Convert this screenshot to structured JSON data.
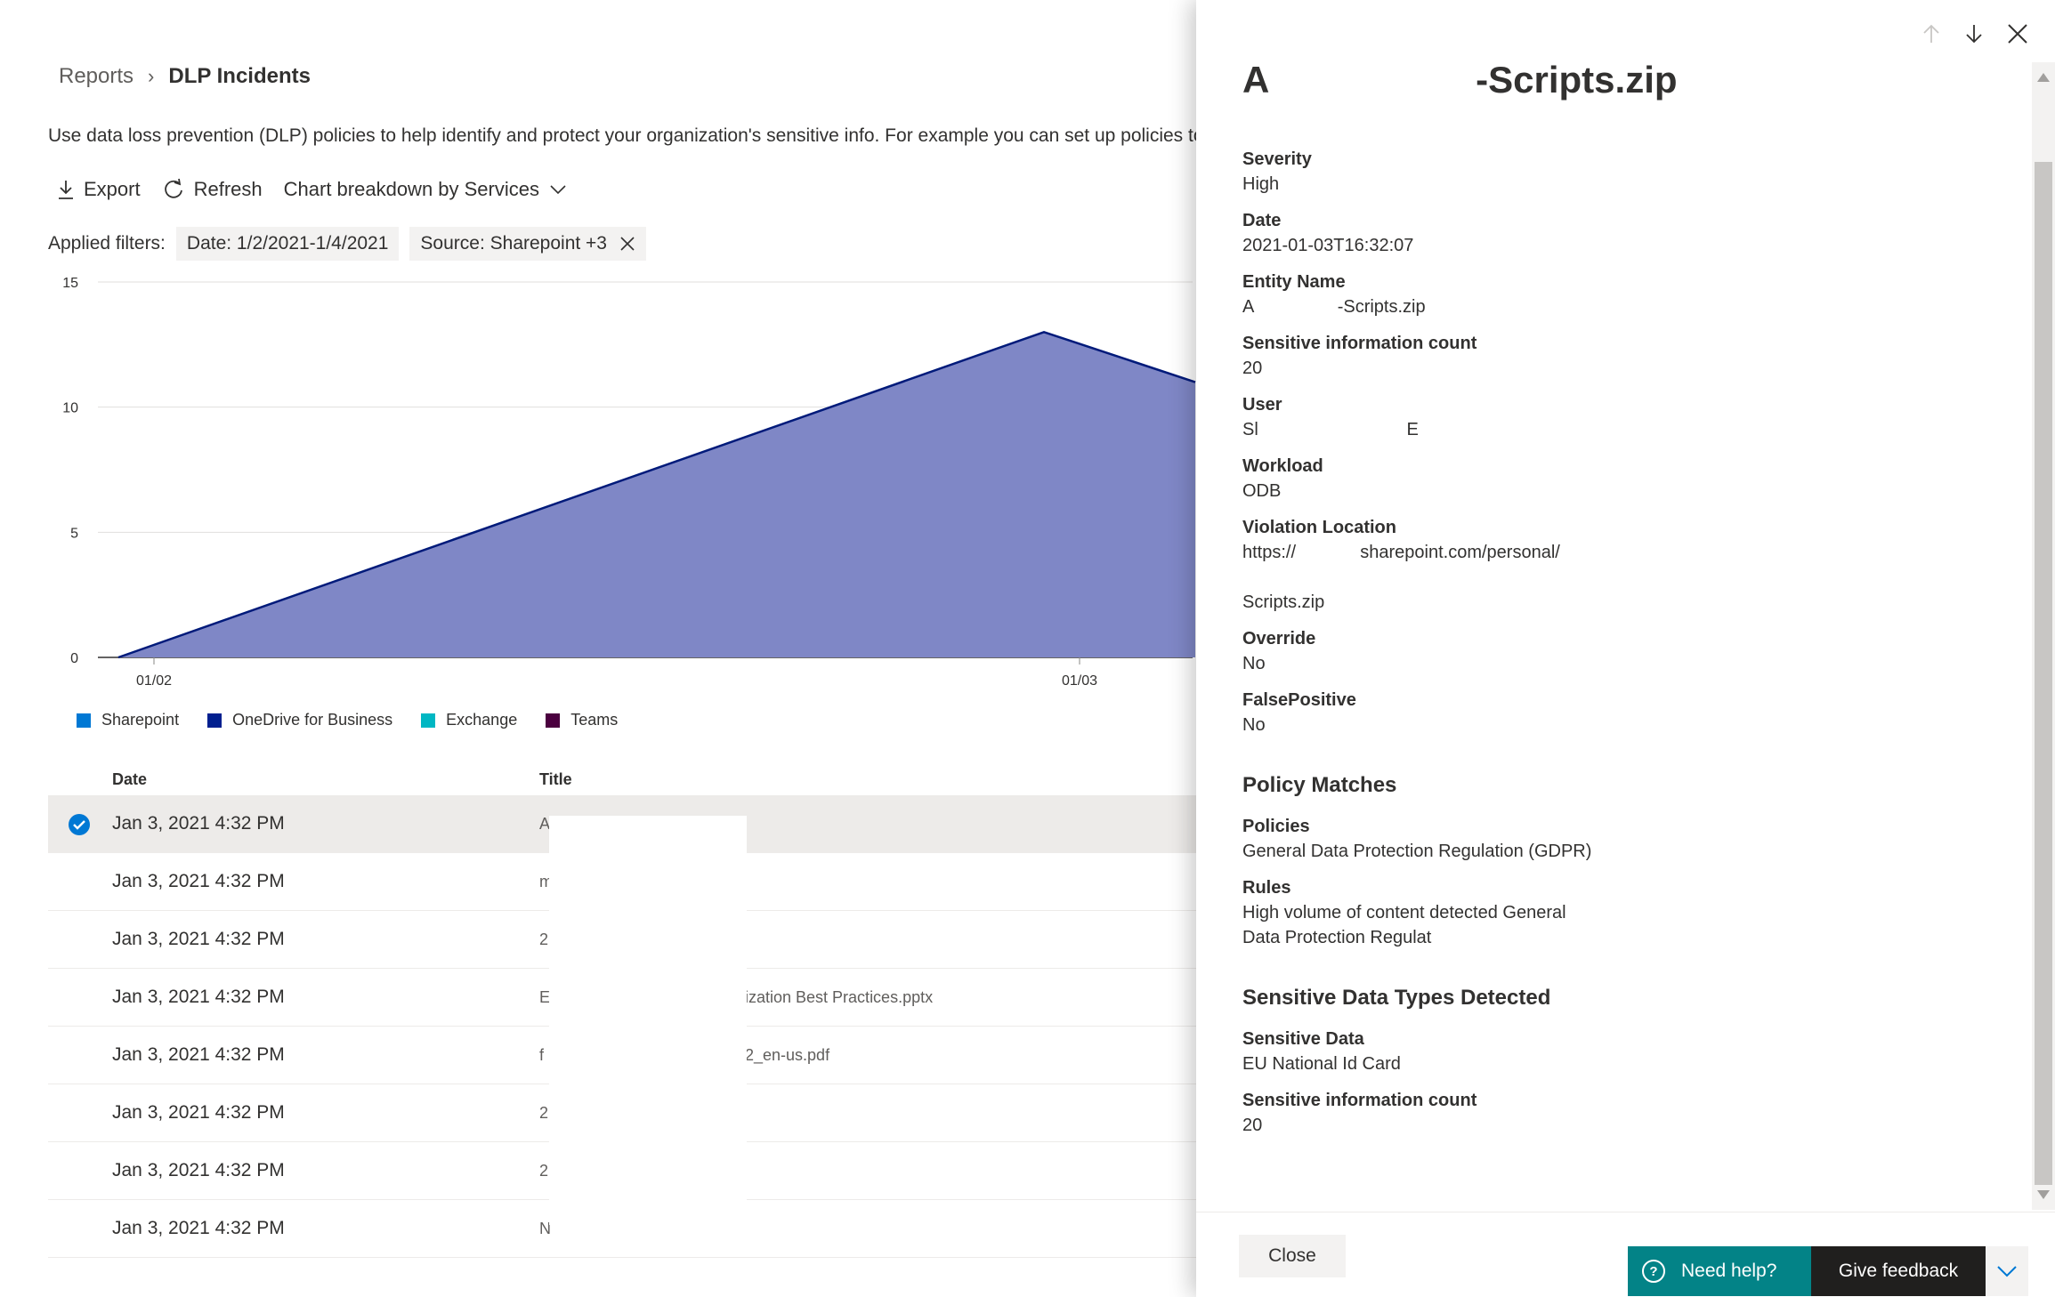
{
  "breadcrumb": {
    "parent": "Reports",
    "current": "DLP Incidents"
  },
  "description": "Use data loss prevention (DLP) policies to help identify and protect your organization's sensitive info. For example you can set up policies to",
  "toolbar": {
    "export": "Export",
    "refresh": "Refresh",
    "breakdown": "Chart breakdown by Services"
  },
  "filters": {
    "label": "Applied filters:",
    "date": "Date: 1/2/2021-1/4/2021",
    "source": "Source: Sharepoint +3"
  },
  "chart_data": {
    "type": "area",
    "x": [
      "01/02",
      "01/03"
    ],
    "x_visible_ticks": [
      "01/02",
      "01/03"
    ],
    "yticks": [
      0,
      5,
      10,
      15
    ],
    "ylim": [
      0,
      15
    ],
    "series": [
      {
        "name": "OneDrive for Business",
        "points": [
          [
            "01/02",
            0
          ],
          [
            "01/03",
            13
          ],
          [
            "01/03+",
            11
          ]
        ]
      }
    ],
    "legend": [
      "Sharepoint",
      "OneDrive for Business",
      "Exchange",
      "Teams"
    ],
    "legend_colors": [
      "#0078d4",
      "#001f8f",
      "#00b7c3",
      "#4b003f"
    ],
    "fill_color": "#7f87c6",
    "line_color": "#001a7a",
    "grid": true
  },
  "table": {
    "columns": [
      "Date",
      "Title"
    ],
    "rows": [
      {
        "date": "Jan 3, 2021 4:32 PM",
        "title": "A",
        "tail": "",
        "selected": true
      },
      {
        "date": "Jan 3, 2021 4:32 PM",
        "title": "m",
        "tail": ""
      },
      {
        "date": "Jan 3, 2021 4:32 PM",
        "title": "2",
        "tail": ""
      },
      {
        "date": "Jan 3, 2021 4:32 PM",
        "title": "E",
        "tail": "ization Best Practices.pptx"
      },
      {
        "date": "Jan 3, 2021 4:32 PM",
        "title": "f",
        "tail": "2_en-us.pdf"
      },
      {
        "date": "Jan 3, 2021 4:32 PM",
        "title": "2",
        "tail": ""
      },
      {
        "date": "Jan 3, 2021 4:32 PM",
        "title": "2",
        "tail": ""
      },
      {
        "date": "Jan 3, 2021 4:32 PM",
        "title": "N",
        "tail": ""
      }
    ]
  },
  "panel": {
    "title": "A                    -Scripts.zip",
    "fields": [
      {
        "k": "Severity",
        "v": "High"
      },
      {
        "k": "Date",
        "v": "2021-01-03T16:32:07"
      },
      {
        "k": "Entity Name",
        "v": "A                 -Scripts.zip"
      },
      {
        "k": "Sensitive information count",
        "v": "20"
      },
      {
        "k": "User",
        "v": "Sl                              E"
      },
      {
        "k": "Workload",
        "v": "ODB"
      },
      {
        "k": "Violation Location",
        "v": "https://             sharepoint.com/personal/\n\nScripts.zip"
      },
      {
        "k": "Override",
        "v": "No"
      },
      {
        "k": "FalsePositive",
        "v": "No"
      }
    ],
    "policy_section": "Policy Matches",
    "policy_fields": [
      {
        "k": "Policies",
        "v": "General Data Protection Regulation (GDPR)"
      },
      {
        "k": "Rules",
        "v": "High volume of content detected General\nData Protection Regulat"
      }
    ],
    "types_section": "Sensitive Data Types Detected",
    "types_fields": [
      {
        "k": "Sensitive Data",
        "v": "EU National Id Card"
      },
      {
        "k": "Sensitive information count",
        "v": "20"
      }
    ],
    "close": "Close"
  },
  "help": {
    "need_help": "Need help?",
    "feedback": "Give feedback"
  }
}
